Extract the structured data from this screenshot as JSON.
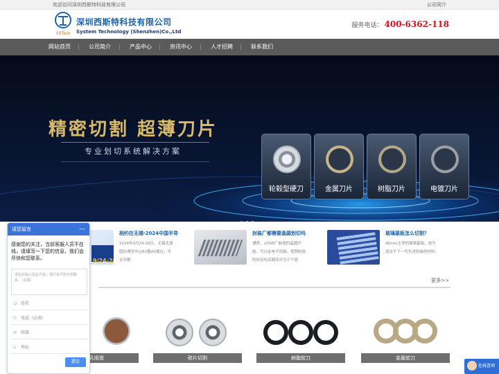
{
  "topbar": {
    "welcome": "欢迎访问深圳西斯特科技有限公司",
    "right_link": "公司简介"
  },
  "header": {
    "logo_text": "SSTech",
    "company_cn": "深圳西斯特科技有限公司",
    "company_en": "System Technology (Shenzhen)Co.,Ltd",
    "hotline_label": "服务电话：",
    "hotline_number": "400-6362-118"
  },
  "nav": [
    "网站首页",
    "公司简介",
    "产品中心",
    "资讯中心",
    "人才招聘",
    "联系我们"
  ],
  "banner": {
    "title": "精密切割 超薄刀片",
    "subtitle": "专业划切系统解决方案",
    "products": [
      "轮毂型硬刀",
      "金属刀片",
      "树脂刀片",
      "电镀刀片"
    ],
    "slide_count": 3,
    "active_slide": 1
  },
  "news": [
    {
      "title": "相约在无锡·2024中国半导",
      "desc": "2024年9月24-26日，无锡太湖国际博览中心B3展A5展位，不见不散",
      "pic_text": "9/24-26"
    },
    {
      "title": "封装厂都需要晶圆划切吗",
      "desc": "通常，从FAB厂制造的晶圆开始，可以在电子封装，按照制造的时间先后顺序分为三个层",
      "pic_text": ""
    },
    {
      "title": "玻璃基板怎么切割？",
      "desc": "由Intel主导的玻璃基板，成为适合于下一代先进封装的材料。",
      "pic_text": ""
    }
  ],
  "more_label": "更多>>",
  "products": [
    {
      "caption": "多孔吸盘"
    },
    {
      "caption": "硅片切割"
    },
    {
      "caption": "树脂软刀"
    },
    {
      "caption": "金属软刀"
    }
  ],
  "chat": {
    "header": "请您留言",
    "close": "—",
    "message": "感谢您的关注，当前客服人员不在线，请填写一下您的信息，我们会尽快和您联系。",
    "textarea_placeholder": "请在此输入留言内容，我们会尽快与您联系。（必填）",
    "fields": [
      "姓名",
      "电话（必填）",
      "邮箱",
      "地址"
    ],
    "submit": "提交"
  },
  "consult_label": "在线咨询",
  "colors": {
    "brand_blue": "#1b63ad",
    "hotline_red": "#c8161d",
    "nav_gray": "#5a5a5a",
    "chat_blue": "#3975d8"
  }
}
